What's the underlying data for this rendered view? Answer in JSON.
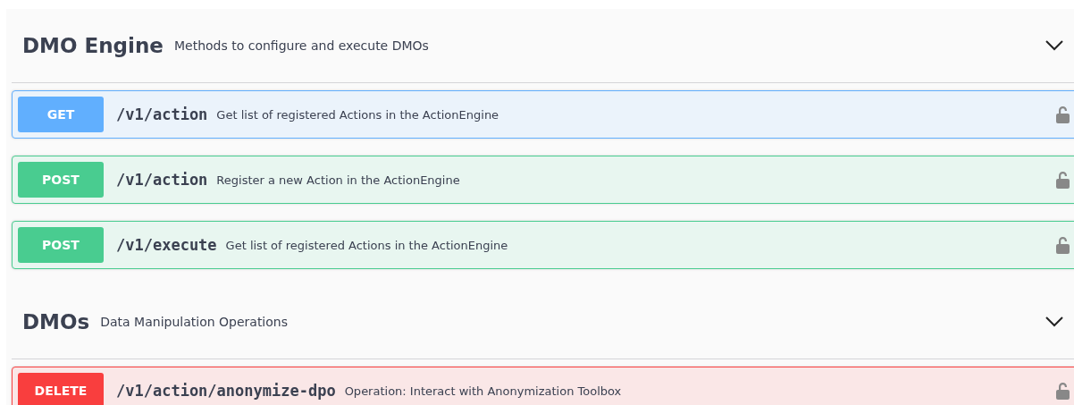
{
  "sections": [
    {
      "title": "DMO Engine",
      "description": "Methods to configure and execute DMOs",
      "expanded": true,
      "operations": [
        {
          "method": "GET",
          "kind": "get",
          "path": "/v1/action",
          "summary": "Get list of registered Actions in the ActionEngine"
        },
        {
          "method": "POST",
          "kind": "post",
          "path": "/v1/action",
          "summary": "Register a new Action in the ActionEngine"
        },
        {
          "method": "POST",
          "kind": "post",
          "path": "/v1/execute",
          "summary": "Get list of registered Actions in the ActionEngine"
        }
      ]
    },
    {
      "title": "DMOs",
      "description": "Data Manipulation Operations",
      "expanded": true,
      "operations": [
        {
          "method": "DELETE",
          "kind": "delete",
          "path": "/v1/action/anonymize-dpo",
          "summary": "Operation: Interact with Anonymization Toolbox"
        }
      ]
    }
  ]
}
